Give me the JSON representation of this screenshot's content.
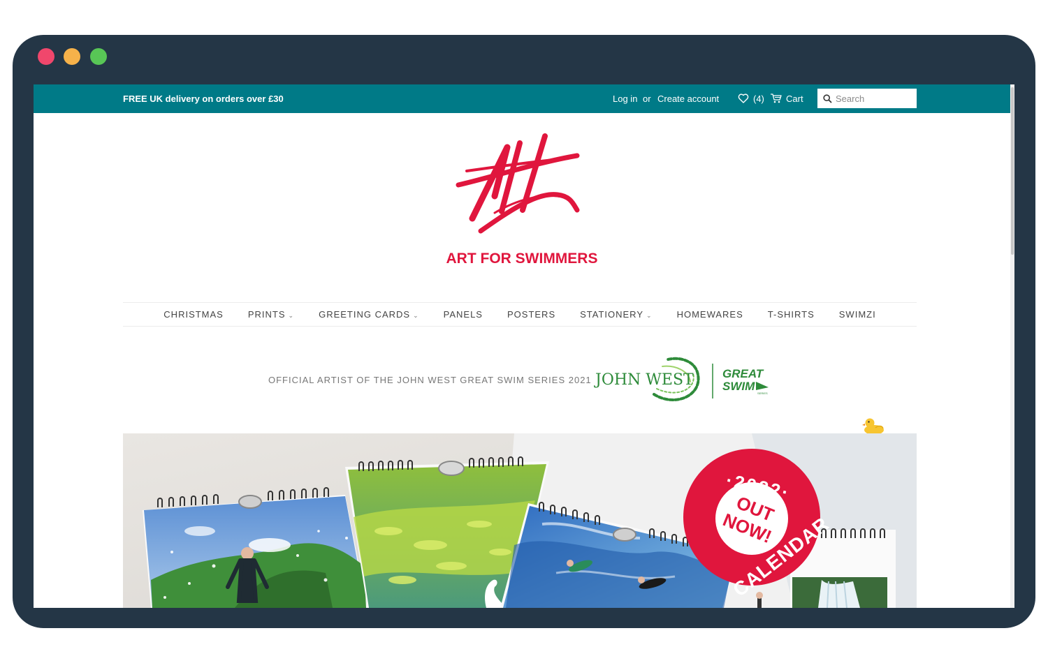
{
  "topbar": {
    "promo": "FREE UK delivery on orders over £30",
    "login": "Log in",
    "or": "or",
    "create_account": "Create account",
    "wishlist_count": "(4)",
    "cart": "Cart",
    "search_placeholder": "Search"
  },
  "brand": {
    "name": "ART FOR SWIMMERS"
  },
  "nav": {
    "items": [
      {
        "label": "CHRISTMAS",
        "dropdown": false
      },
      {
        "label": "PRINTS",
        "dropdown": true
      },
      {
        "label": "GREETING CARDS",
        "dropdown": true
      },
      {
        "label": "PANELS",
        "dropdown": false
      },
      {
        "label": "POSTERS",
        "dropdown": false
      },
      {
        "label": "STATIONERY",
        "dropdown": true
      },
      {
        "label": "HOMEWARES",
        "dropdown": false
      },
      {
        "label": "T-SHIRTS",
        "dropdown": false
      },
      {
        "label": "SWIMZI",
        "dropdown": false
      }
    ],
    "caret": "⌄"
  },
  "official": {
    "text": "OFFICIAL ARTIST OF THE JOHN WEST GREAT SWIM SERIES 2021",
    "john_west": "JOHN WEST",
    "great": "GREAT",
    "swim": "SWIM",
    "series": "SERIES"
  },
  "hero": {
    "badge_year": "·2022·",
    "badge_out": "OUT",
    "badge_now": "NOW!",
    "badge_calendar": "CALENDAR"
  },
  "colors": {
    "topbar": "#007a87",
    "brand_red": "#e0163d",
    "frame": "#243646",
    "john_west_green": "#2e8b3a"
  }
}
